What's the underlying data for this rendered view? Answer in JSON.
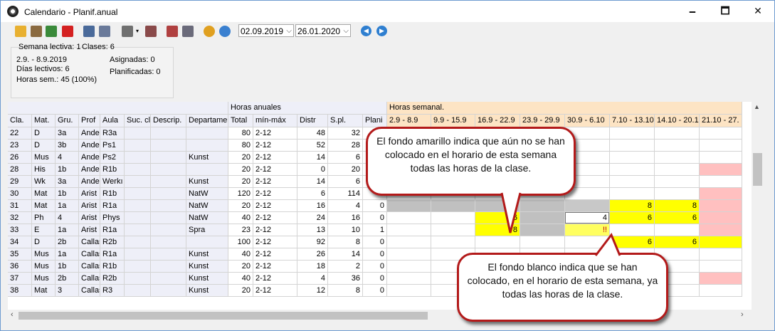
{
  "window": {
    "title": "Calendario - Planif.anual",
    "minimize": "🗕",
    "maximize": "🗖",
    "close": "✕"
  },
  "toolbar": {
    "icons": [
      "lock-icon",
      "key-icon",
      "exit-icon",
      "delete-icon",
      "calculator-icon",
      "print-icon",
      "filter-icon",
      "filter-clear-icon",
      "schedule-icon",
      "export-icon",
      "settings-icon",
      "refresh-icon"
    ],
    "date_from": "02.09.2019",
    "date_to": "26.01.2020"
  },
  "info": {
    "week": "Semana lectiva: 1",
    "classes": "Clases: 6",
    "range": "2.9. - 8.9.2019",
    "days": "Días lectivos: 6",
    "hours": "Horas sem.: 45 (100%)",
    "assigned": "Asignadas: 0",
    "planned": "Planificadas: 0"
  },
  "grid": {
    "group_annual": "Horas anuales",
    "group_weekly": "Horas semanal.",
    "headers": [
      "Cla.",
      "Mat.",
      "Gru.",
      "Prof",
      "Aula",
      "Suc. cl",
      "Descrip.",
      "Departame",
      "Total",
      "mín-máx",
      "Distr",
      "S.pl.",
      "Plani"
    ],
    "weeks": [
      "2.9 - 8.9",
      "9.9 - 15.9",
      "16.9 - 22.9",
      "23.9 - 29.9",
      "30.9 - 6.10",
      "7.10 - 13.10",
      "14.10 - 20.1",
      "21.10 - 27."
    ],
    "rows": [
      {
        "c": [
          "22",
          "D",
          "3a",
          "Ander",
          "R3a",
          "",
          "",
          "",
          "80",
          "2-12",
          "48",
          "32",
          ""
        ]
      },
      {
        "c": [
          "23",
          "D",
          "3b",
          "Ander",
          "Ps1",
          "",
          "",
          "",
          "80",
          "2-12",
          "52",
          "28",
          ""
        ]
      },
      {
        "c": [
          "26",
          "Mus",
          "4",
          "Ander",
          "Ps2",
          "",
          "",
          "Kunst",
          "20",
          "2-12",
          "14",
          "6",
          ""
        ]
      },
      {
        "c": [
          "28",
          "His",
          "1b",
          "Ander",
          "R1b",
          "",
          "",
          "",
          "20",
          "2-12",
          "0",
          "20",
          ""
        ]
      },
      {
        "c": [
          "29",
          "Wk",
          "3a",
          "Ander",
          "Werkı",
          "",
          "",
          "Kunst",
          "20",
          "2-12",
          "14",
          "6",
          ""
        ]
      },
      {
        "c": [
          "30",
          "Mat",
          "1b",
          "Arist",
          "R1b",
          "",
          "",
          "NatW",
          "120",
          "2-12",
          "6",
          "114",
          "0"
        ]
      },
      {
        "c": [
          "31",
          "Mat",
          "1a",
          "Arist",
          "R1a",
          "",
          "",
          "NatW",
          "20",
          "2-12",
          "16",
          "4",
          "0"
        ]
      },
      {
        "c": [
          "32",
          "Ph",
          "4",
          "Arist",
          "Phys",
          "",
          "",
          "NatW",
          "40",
          "2-12",
          "24",
          "16",
          "0"
        ]
      },
      {
        "c": [
          "33",
          "E",
          "1a",
          "Arist",
          "R1a",
          "",
          "",
          "Spra",
          "23",
          "2-12",
          "13",
          "10",
          "1"
        ]
      },
      {
        "c": [
          "34",
          "D",
          "2b",
          "Callas",
          "R2b",
          "",
          "",
          "",
          "100",
          "2-12",
          "92",
          "8",
          "0"
        ]
      },
      {
        "c": [
          "35",
          "Mus",
          "1a",
          "Callas",
          "R1a",
          "",
          "",
          "Kunst",
          "40",
          "2-12",
          "26",
          "14",
          "0"
        ]
      },
      {
        "c": [
          "36",
          "Mus",
          "1b",
          "Callas",
          "R1b",
          "",
          "",
          "Kunst",
          "20",
          "2-12",
          "18",
          "2",
          "0"
        ]
      },
      {
        "c": [
          "37",
          "Mus",
          "2b",
          "Callas",
          "R2b",
          "",
          "",
          "Kunst",
          "40",
          "2-12",
          "4",
          "36",
          "0"
        ]
      },
      {
        "c": [
          "38",
          "Mat",
          "3",
          "Callas",
          "R3",
          "",
          "",
          "Kunst",
          "20",
          "2-12",
          "12",
          "8",
          "0"
        ]
      }
    ],
    "week_cells": [
      [],
      [],
      [],
      [
        {
          "w": 7,
          "color": "#ffc0c0",
          "v": ""
        }
      ],
      [],
      [
        {
          "w": 7,
          "color": "#ffc0c0",
          "v": ""
        }
      ],
      [
        {
          "w": 0,
          "color": "#c0c0c0",
          "v": ""
        },
        {
          "w": 1,
          "color": "#c0c0c0",
          "v": ""
        },
        {
          "w": 2,
          "color": "#c0c0c0",
          "v": ""
        },
        {
          "w": 3,
          "color": "#c0c0c0",
          "v": ""
        },
        {
          "w": 4,
          "color": "#c8c8c8",
          "v": ""
        },
        {
          "w": 5,
          "color": "#ffff00",
          "v": "8"
        },
        {
          "w": 6,
          "color": "#ffff00",
          "v": "8"
        },
        {
          "w": 7,
          "color": "#ffc0c0",
          "v": ""
        }
      ],
      [
        {
          "w": 2,
          "color": "#ffff00",
          "v": "6"
        },
        {
          "w": 3,
          "color": "#c0c0c0",
          "v": ""
        },
        {
          "w": 4,
          "color": "#ffffff",
          "v": "4",
          "boxed": true
        },
        {
          "w": 5,
          "color": "#ffff00",
          "v": "6"
        },
        {
          "w": 6,
          "color": "#ffff00",
          "v": "6"
        },
        {
          "w": 7,
          "color": "#ffc0c0",
          "v": ""
        }
      ],
      [
        {
          "w": 2,
          "color": "#ffff00",
          "v": "8"
        },
        {
          "w": 3,
          "color": "#c0c0c0",
          "v": ""
        },
        {
          "w": 4,
          "color": "#ffff60",
          "v": "!!"
        },
        {
          "w": 7,
          "color": "#ffc0c0",
          "v": ""
        }
      ],
      [
        {
          "w": 5,
          "color": "#ffff00",
          "v": "6"
        },
        {
          "w": 6,
          "color": "#ffff00",
          "v": "6"
        },
        {
          "w": 7,
          "color": "#ffff00",
          "v": ""
        }
      ],
      [],
      [],
      [
        {
          "w": 7,
          "color": "#ffc0c0",
          "v": ""
        }
      ],
      []
    ]
  },
  "callouts": {
    "yellow": "El fondo amarillo indica que aún no se han colocado en el horario de esta semana todas las horas de la clase.",
    "white": "El fondo blanco indica que se han colocado, en el horario de esta semana, ya todas las horas de la clase."
  },
  "colors": {
    "yellow": "#ffff00",
    "grey": "#c0c0c0",
    "pink": "#ffc0c0",
    "header": "#eeeff8",
    "week_header": "#fde4c4",
    "callout_border": "#b31a1a"
  }
}
